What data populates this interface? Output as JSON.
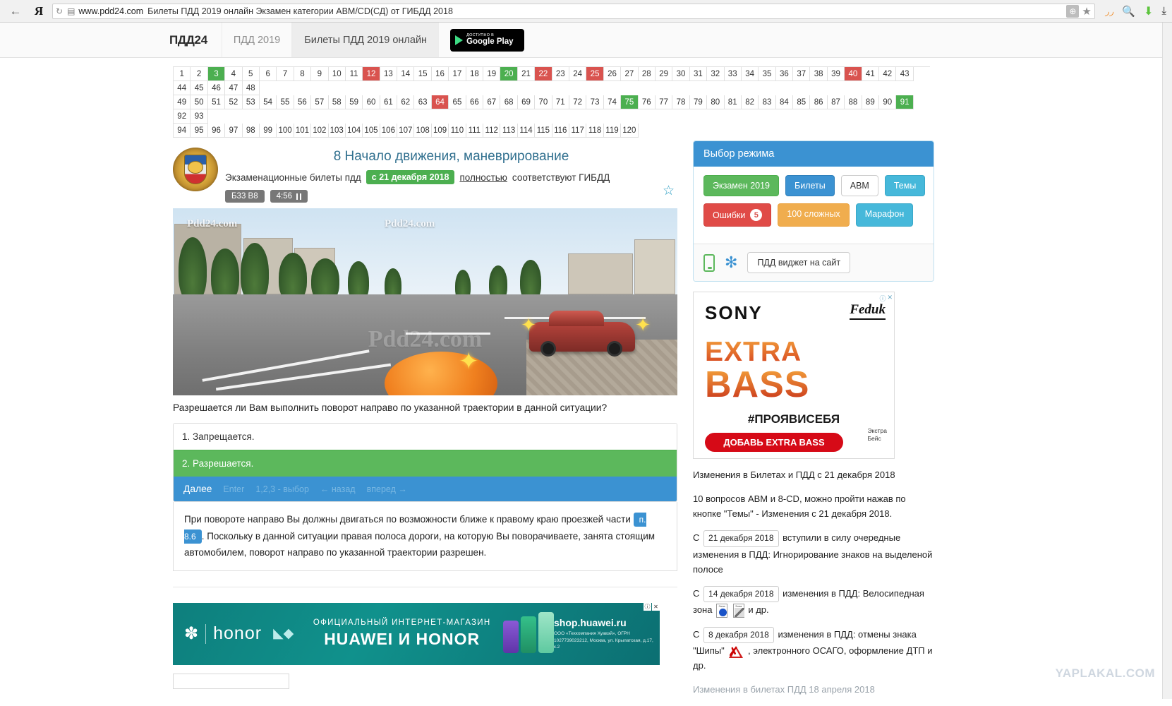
{
  "browser": {
    "back_icon": "back-arrow-icon",
    "yandex_logo": "Я",
    "reload_icon": "↻",
    "page_icon": "page-icon",
    "url_host": "www.pdd24.com",
    "url_title": "Билеты ПДД 2019 онлайн Экзамен категории АВМ/CD(СД) от ГИБДД 2018",
    "globe_badge": "⊕",
    "bookmark_icon": "★",
    "rss_icon": "rss-icon",
    "search_icon": "search-icon",
    "download_icon": "download-icon",
    "save_icon": "save-icon"
  },
  "site_header": {
    "brand": "ПДД24",
    "tabs": [
      {
        "label": "ПДД 2019",
        "active": false
      },
      {
        "label": "Билеты ПДД 2019 онлайн",
        "active": true
      }
    ],
    "google_play": {
      "line1": "ДОСТУПНО В",
      "line2": "Google Play"
    }
  },
  "number_grid": {
    "rows": [
      [
        {
          "n": "1"
        },
        {
          "n": "2"
        },
        {
          "n": "3",
          "s": "green"
        },
        {
          "n": "4"
        },
        {
          "n": "5"
        },
        {
          "n": "6"
        },
        {
          "n": "7"
        },
        {
          "n": "8"
        },
        {
          "n": "9"
        },
        {
          "n": "10"
        },
        {
          "n": "11"
        },
        {
          "n": "12",
          "s": "red"
        },
        {
          "n": "13"
        },
        {
          "n": "14"
        },
        {
          "n": "15"
        },
        {
          "n": "16"
        },
        {
          "n": "17"
        },
        {
          "n": "18"
        },
        {
          "n": "19"
        },
        {
          "n": "20",
          "s": "green"
        },
        {
          "n": "21"
        },
        {
          "n": "22",
          "s": "red"
        },
        {
          "n": "23"
        },
        {
          "n": "24"
        },
        {
          "n": "25",
          "s": "red"
        },
        {
          "n": "26"
        },
        {
          "n": "27"
        },
        {
          "n": "28"
        },
        {
          "n": "29"
        },
        {
          "n": "30"
        },
        {
          "n": "31"
        },
        {
          "n": "32"
        },
        {
          "n": "33"
        },
        {
          "n": "34"
        },
        {
          "n": "35"
        },
        {
          "n": "36"
        },
        {
          "n": "37"
        },
        {
          "n": "38"
        },
        {
          "n": "39"
        },
        {
          "n": "40",
          "s": "red"
        },
        {
          "n": "41"
        },
        {
          "n": "42"
        },
        {
          "n": "43"
        },
        {
          "n": "44"
        },
        {
          "n": "45"
        },
        {
          "n": "46"
        },
        {
          "n": "47"
        },
        {
          "n": "48"
        }
      ],
      [
        {
          "n": "49"
        },
        {
          "n": "50"
        },
        {
          "n": "51"
        },
        {
          "n": "52"
        },
        {
          "n": "53"
        },
        {
          "n": "54"
        },
        {
          "n": "55"
        },
        {
          "n": "56"
        },
        {
          "n": "57"
        },
        {
          "n": "58"
        },
        {
          "n": "59"
        },
        {
          "n": "60"
        },
        {
          "n": "61"
        },
        {
          "n": "62"
        },
        {
          "n": "63"
        },
        {
          "n": "64",
          "s": "red"
        },
        {
          "n": "65"
        },
        {
          "n": "66"
        },
        {
          "n": "67"
        },
        {
          "n": "68"
        },
        {
          "n": "69"
        },
        {
          "n": "70"
        },
        {
          "n": "71"
        },
        {
          "n": "72"
        },
        {
          "n": "73"
        },
        {
          "n": "74"
        },
        {
          "n": "75",
          "s": "green"
        },
        {
          "n": "76"
        },
        {
          "n": "77"
        },
        {
          "n": "78"
        },
        {
          "n": "79"
        },
        {
          "n": "80"
        },
        {
          "n": "81"
        },
        {
          "n": "82"
        },
        {
          "n": "83"
        },
        {
          "n": "84"
        },
        {
          "n": "85"
        },
        {
          "n": "86"
        },
        {
          "n": "87"
        },
        {
          "n": "88"
        },
        {
          "n": "89"
        },
        {
          "n": "90"
        },
        {
          "n": "91",
          "s": "green"
        },
        {
          "n": "92"
        },
        {
          "n": "93"
        }
      ],
      [
        {
          "n": "94"
        },
        {
          "n": "95"
        },
        {
          "n": "96"
        },
        {
          "n": "97"
        },
        {
          "n": "98"
        },
        {
          "n": "99"
        },
        {
          "n": "100"
        },
        {
          "n": "101"
        },
        {
          "n": "102"
        },
        {
          "n": "103"
        },
        {
          "n": "104"
        },
        {
          "n": "105"
        },
        {
          "n": "106"
        },
        {
          "n": "107"
        },
        {
          "n": "108"
        },
        {
          "n": "109"
        },
        {
          "n": "110"
        },
        {
          "n": "111"
        },
        {
          "n": "112"
        },
        {
          "n": "113"
        },
        {
          "n": "114"
        },
        {
          "n": "115"
        },
        {
          "n": "116"
        },
        {
          "n": "117"
        },
        {
          "n": "118"
        },
        {
          "n": "119"
        },
        {
          "n": "120"
        }
      ]
    ]
  },
  "question": {
    "emblem_alt": "gibdd-emblem",
    "title": "8 Начало движения, маневрирование",
    "sub_prefix": "Экзаменационные билеты пдд",
    "sub_badge": "с 21 декабря 2018",
    "sub_link": "полностью",
    "sub_suffix": "соответствуют ГИБДД",
    "ticket_chip": "Б33 В8",
    "timer_chip": "4:56",
    "favorite_icon": "☆",
    "watermark": "Pdd24.com",
    "watermark_big": "Pdd24.com",
    "text": "Разрешается ли Вам выполнить поворот направо по указанной траектории в данной ситуации?",
    "answers": [
      {
        "label": "1. Запрещается.",
        "correct": false
      },
      {
        "label": "2. Разрешается.",
        "correct": true
      }
    ],
    "next_bar": {
      "main": "Далее",
      "hint_enter": "Enter",
      "hint_choice": "1,2,3 - выбор",
      "hint_back": "← назад",
      "hint_forward": "вперед →"
    },
    "explanation_part1": "При повороте направо Вы должны двигаться по возможности ближе к правому краю проезжей части",
    "explanation_clause": "п. 8.6",
    "explanation_part2": ". Поскольку в данной ситуации правая полоса дороги, на которую Вы поворачиваете, занята стоящим автомобилем, поворот направо по указанной траектории разрешен."
  },
  "mode_panel": {
    "title": "Выбор режима",
    "buttons_row1": [
      {
        "label": "Экзамен 2019",
        "style": "green"
      },
      {
        "label": "Билеты",
        "style": "blue"
      },
      {
        "label": "АВМ",
        "style": "white"
      },
      {
        "label": "Темы",
        "style": "teal"
      }
    ],
    "buttons_row2": [
      {
        "label": "Ошибки",
        "style": "red",
        "count": "5"
      },
      {
        "label": "100 сложных",
        "style": "orange"
      },
      {
        "label": "Марафон",
        "style": "teal"
      }
    ],
    "phone_icon": "phone-icon",
    "gear_icon": "gear-icon",
    "widget_button": "ПДД виджет на сайт"
  },
  "sony_ad": {
    "brand": "SONY",
    "artist": "Feduk",
    "line1": "EXTRA",
    "line2": "BASS",
    "hashtag": "#ПРОЯВИСЕБЯ",
    "cta": "ДОБАВЬ EXTRA BASS",
    "fine1": "Экстра",
    "fine2": "Бейс",
    "ad_mark": "ⓘ",
    "close_mark": "✕"
  },
  "news": [
    {
      "text": "Изменения в Билетах и ПДД с 21 декабря 2018"
    },
    {
      "text": "10 вопросов АВМ и 8-CD, можно пройти нажав по кнопке \"Темы\" - Изменения с 21 декабря 2018."
    }
  ],
  "news_dated": [
    {
      "prefix": "С",
      "date": "21 декабря 2018",
      "suffix": "вступили в силу очередные изменения в ПДД: Игнорирование знаков на выделеной полосе"
    },
    {
      "prefix": "С",
      "date": "14 декабря 2018",
      "mid": "изменения в ПДД: Велосипедная зона",
      "suffix": "и др.",
      "sign1": "Зона",
      "sign2": "Зона"
    },
    {
      "prefix": "С",
      "date": "8 декабря 2018",
      "mid": "изменения в ПДД: отмены знака",
      "quoted": "\"Шипы\"",
      "suffix": ", электронного ОСАГО, оформление ДТП и др."
    }
  ],
  "news_cut": "Изменения в билетах ПДД 18 апреля 2018",
  "huawei_ad": {
    "brand_flower": "huawei-flower-icon",
    "honor": "honor",
    "line1": "ОФИЦИАЛЬНЫЙ ИНТЕРНЕТ-МАГАЗИН",
    "line2": "HUAWEI И HONOR",
    "site": "shop.huawei.ru",
    "fine": "ООО «Техкомпания Хуавэй», ОГРН 1027739023212, Москва, ул. Крылатская, д.17, к.2",
    "ad_mark": "ⓘ",
    "close_mark": "✕"
  },
  "watermark_overlay": "YAPLAKAL.COM",
  "colors": {
    "accent_blue": "#3b92d2",
    "green": "#5cb85c",
    "red": "#d9534f",
    "orange": "#f0ad4e",
    "teal": "#46b8da"
  }
}
